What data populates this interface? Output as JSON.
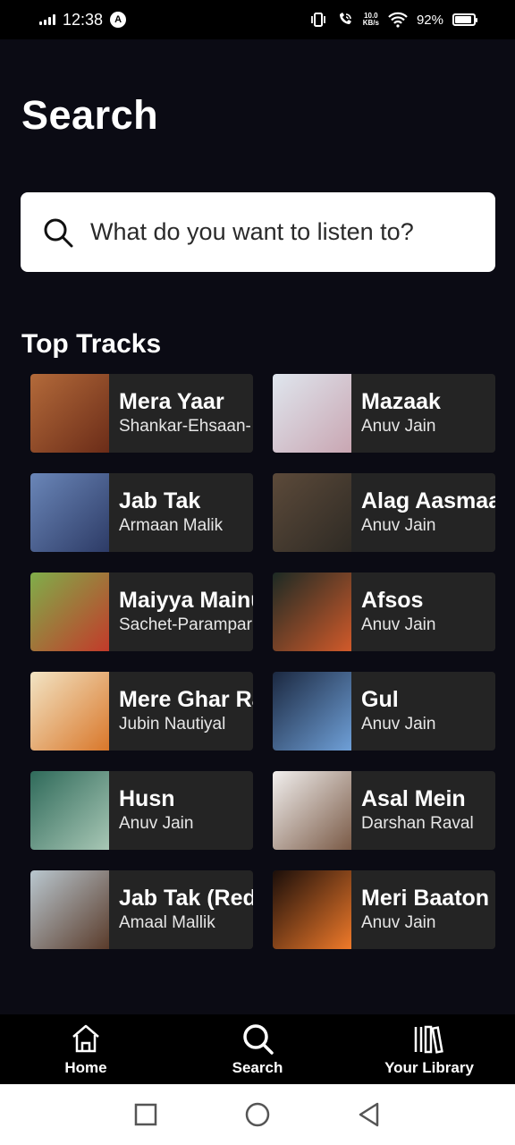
{
  "status_bar": {
    "time": "12:38",
    "app_badge": "A",
    "speed_top": "10.0",
    "speed_bottom": "KB/s",
    "battery": "92%",
    "battery_level": 0.92
  },
  "page_title": "Search",
  "search": {
    "placeholder": "What do you want to listen to?",
    "icon": "search-icon"
  },
  "section_title": "Top Tracks",
  "tracks": [
    {
      "title": "Mera Yaar",
      "artist": "Shankar-Ehsaan-",
      "art_colors": [
        "#b36a3a",
        "#6b2c18"
      ]
    },
    {
      "title": "Mazaak",
      "artist": "Anuv Jain",
      "art_colors": [
        "#dfe6ee",
        "#c9a6b2"
      ]
    },
    {
      "title": "Jab Tak",
      "artist": "Armaan Malik",
      "art_colors": [
        "#6a86b8",
        "#2d3b66"
      ]
    },
    {
      "title": "Alag Aasmaa",
      "artist": "Anuv Jain",
      "art_colors": [
        "#5c4a3a",
        "#2e2a24"
      ]
    },
    {
      "title": "Maiyya Mainu",
      "artist": "Sachet-Parampar",
      "art_colors": [
        "#7fae4a",
        "#c33a2a"
      ]
    },
    {
      "title": "Afsos",
      "artist": "Anuv Jain",
      "art_colors": [
        "#1c2a24",
        "#d25a2a"
      ]
    },
    {
      "title": "Mere Ghar Ram",
      "artist": "Jubin Nautiyal",
      "art_colors": [
        "#f2e4c4",
        "#d9772a"
      ]
    },
    {
      "title": "Gul",
      "artist": "Anuv Jain",
      "art_colors": [
        "#1b2840",
        "#6fa0d8"
      ]
    },
    {
      "title": "Husn",
      "artist": "Anuv Jain",
      "art_colors": [
        "#2f6a5a",
        "#a8c7b5"
      ]
    },
    {
      "title": "Asal Mein",
      "artist": "Darshan Raval",
      "art_colors": [
        "#f1efee",
        "#7a5a46"
      ]
    },
    {
      "title": "Jab Tak (Redu",
      "artist": "Amaal Mallik",
      "art_colors": [
        "#b9c7cf",
        "#5a3b2a"
      ]
    },
    {
      "title": "Meri Baaton",
      "artist": "Anuv Jain",
      "art_colors": [
        "#1a0e0a",
        "#f07a2a"
      ]
    }
  ],
  "bottom_nav": [
    {
      "label": "Home",
      "icon": "home-icon"
    },
    {
      "label": "Search",
      "icon": "search-icon"
    },
    {
      "label": "Your Library",
      "icon": "library-icon"
    }
  ],
  "system_nav": [
    "recent-apps-icon",
    "home-circle-icon",
    "back-icon"
  ]
}
